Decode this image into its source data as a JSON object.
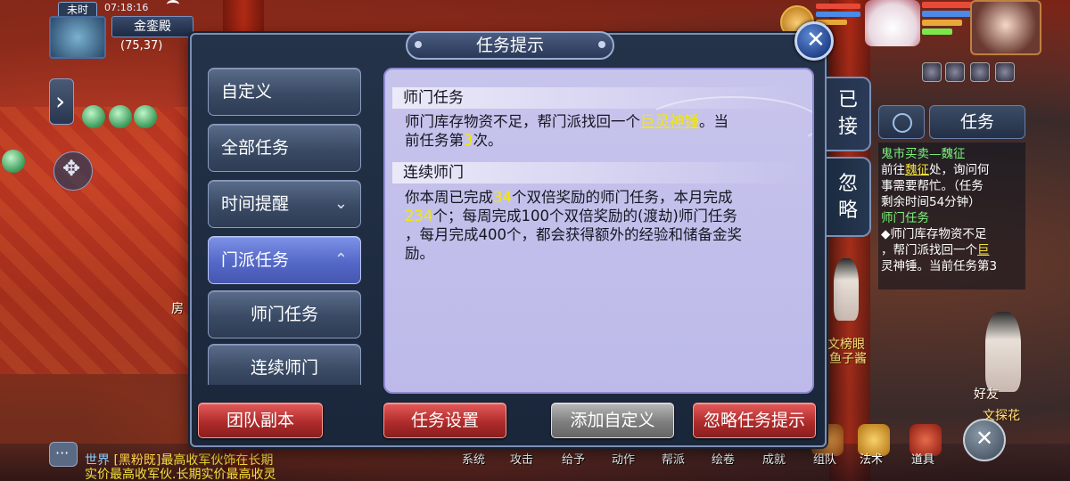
{
  "hud": {
    "time_slot": "未时",
    "clock": "07:18:16",
    "location_name": "金銮殿",
    "coords": "(75,37)"
  },
  "dialog": {
    "title": "任务提示",
    "categories": [
      {
        "label": "自定义"
      },
      {
        "label": "全部任务"
      },
      {
        "label": "时间提醒",
        "chevron": "⌄"
      },
      {
        "label": "门派任务",
        "chevron": "⌃"
      },
      {
        "label": "师门任务"
      },
      {
        "label": "连续师门"
      }
    ],
    "side_tabs": {
      "accepted": [
        "已",
        "接"
      ],
      "ignored": [
        "忽",
        "略"
      ]
    },
    "sections": [
      {
        "title": "师门任务",
        "line1_a": "师门库存物资不足，帮门派找回一个",
        "line1_item": "巨灵神锤",
        "line1_b": "。当",
        "line2_a": "前任务第",
        "line2_num": "3",
        "line2_b": "次。"
      },
      {
        "title": "连续师门",
        "l1_a": "你本周已完成",
        "l1_num": "34",
        "l1_b": "个双倍奖励的师门任务，本月完成",
        "l2_num": "234",
        "l2_b": "个；每周完成100个双倍奖励的(渡劫)师门任务",
        "l3": "，每月完成400个，都会获得额外的经验和储备金奖",
        "l4": "励。"
      }
    ],
    "buttons": {
      "team_dungeon": "团队副本",
      "task_settings": "任务设置",
      "add_custom": "添加自定义",
      "ignore_hint": "忽略任务提示"
    }
  },
  "tracker": {
    "header": "任务",
    "task1_name": "鬼市买卖—魏征",
    "task1_l1_a": "前往",
    "task1_l1_hl": "魏征",
    "task1_l1_b": "处，询问何",
    "task1_l2": "事需要帮忙。（任务",
    "task1_l3": "剩余时间54分钟）",
    "task2_name": "师门任务",
    "task2_l1": "◆师门库存物资不足",
    "task2_l2_a": "，帮门派找回一个",
    "task2_l2_hl": "巨",
    "task2_l3": "灵神锤。当前任务第3"
  },
  "world_labels": {
    "label_a": "文榜眼",
    "label_b": "鱼子酱",
    "label_c": "好友",
    "label_d": "文探花",
    "label_e": "房"
  },
  "chat": {
    "channel": "世界",
    "name": "[黑粉既]",
    "msg1": "最高收军伙饰在长期",
    "msg2": "实价最高收军伙.长期实价最高收灵"
  },
  "dock": [
    "系统",
    "攻击",
    "给予",
    "动作",
    "帮派",
    "绘卷",
    "成就",
    "组队",
    "法术",
    "道具"
  ]
}
